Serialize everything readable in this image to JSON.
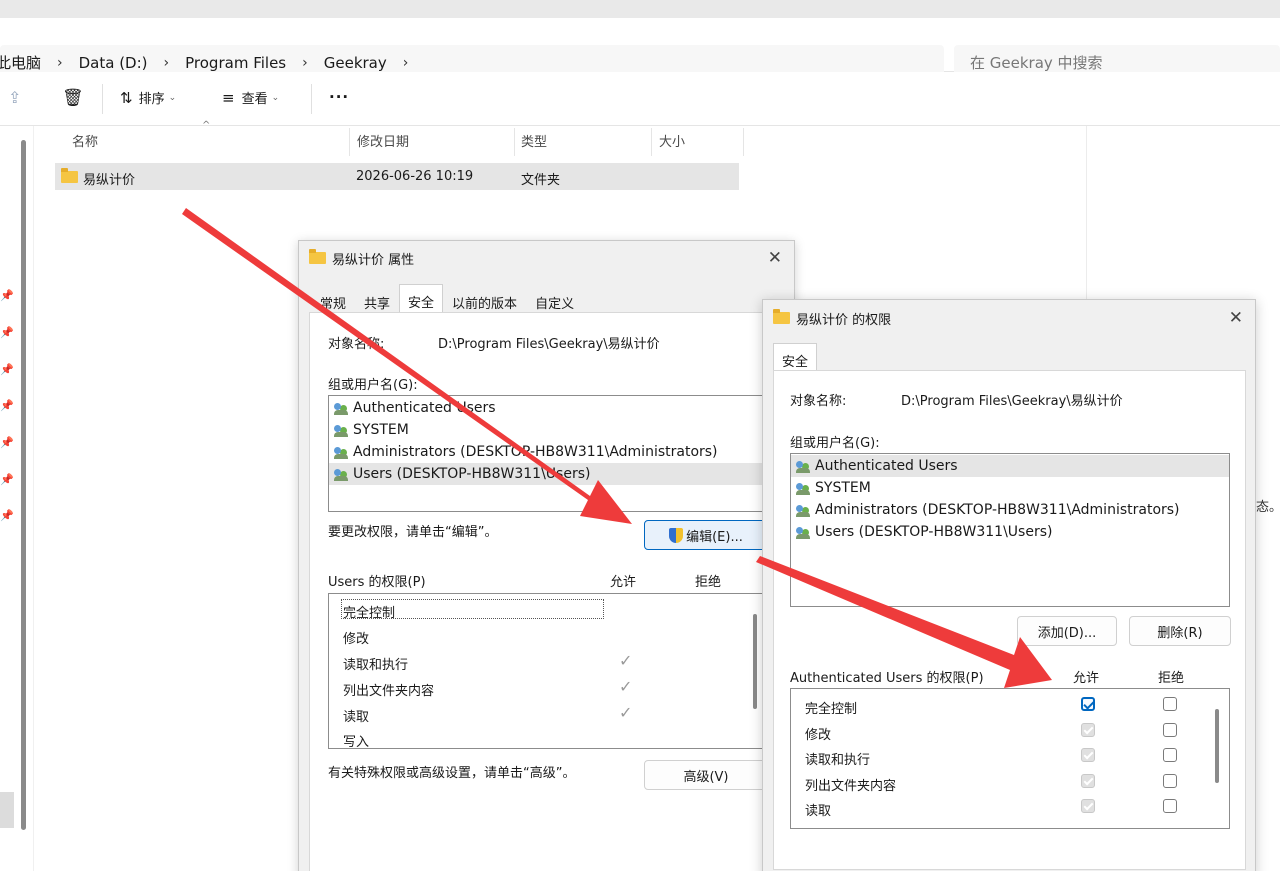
{
  "breadcrumb": {
    "items": [
      "此电脑",
      "Data (D:)",
      "Program Files",
      "Geekray"
    ],
    "trailing_sep": "›"
  },
  "search": {
    "placeholder": "在 Geekray 中搜索"
  },
  "toolbar": {
    "sort_label": "排序",
    "view_label": "查看",
    "more_label": "···"
  },
  "columns": {
    "name": "名称",
    "modified": "修改日期",
    "type": "类型",
    "size": "大小"
  },
  "files": [
    {
      "name": "易纵计价",
      "modified": "2026-06-26 10:19",
      "type": "文件夹"
    }
  ],
  "clipped_text": "态。",
  "properties_dialog": {
    "title": "易纵计价 属性",
    "tabs": [
      "常规",
      "共享",
      "安全",
      "以前的版本",
      "自定义"
    ],
    "active_tab": "安全",
    "object_label": "对象名称:",
    "object_value": "D:\\Program Files\\Geekray\\易纵计价",
    "group_label": "组或用户名(G):",
    "users": [
      "Authenticated Users",
      "SYSTEM",
      "Administrators (DESKTOP-HB8W311\\Administrators)",
      "Users (DESKTOP-HB8W311\\Users)"
    ],
    "selected_user_index": 3,
    "edit_hint": "要更改权限，请单击“编辑”。",
    "edit_button": "编辑(E)...",
    "perm_label": "Users 的权限(P)",
    "allow_label": "允许",
    "deny_label": "拒绝",
    "permissions": [
      {
        "name": "完全控制",
        "allow": false,
        "deny": false
      },
      {
        "name": "修改",
        "allow": false,
        "deny": false
      },
      {
        "name": "读取和执行",
        "allow": true,
        "deny": false
      },
      {
        "name": "列出文件夹内容",
        "allow": true,
        "deny": false
      },
      {
        "name": "读取",
        "allow": true,
        "deny": false
      },
      {
        "name": "写入",
        "allow": false,
        "deny": false
      }
    ],
    "advanced_hint": "有关特殊权限或高级设置，请单击“高级”。",
    "advanced_button": "高级(V)"
  },
  "permissions_dialog": {
    "title": "易纵计价 的权限",
    "tab": "安全",
    "object_label": "对象名称:",
    "object_value": "D:\\Program Files\\Geekray\\易纵计价",
    "group_label": "组或用户名(G):",
    "users": [
      "Authenticated Users",
      "SYSTEM",
      "Administrators (DESKTOP-HB8W311\\Administrators)",
      "Users (DESKTOP-HB8W311\\Users)"
    ],
    "selected_user_index": 0,
    "add_button": "添加(D)...",
    "remove_button": "删除(R)",
    "perm_label": "Authenticated Users 的权限(P)",
    "allow_label": "允许",
    "deny_label": "拒绝",
    "permissions": [
      {
        "name": "完全控制",
        "allow": "checked-editable",
        "deny": false
      },
      {
        "name": "修改",
        "allow": "checked-disabled",
        "deny": false
      },
      {
        "name": "读取和执行",
        "allow": "checked-disabled",
        "deny": false
      },
      {
        "name": "列出文件夹内容",
        "allow": "checked-disabled",
        "deny": false
      },
      {
        "name": "读取",
        "allow": "checked-disabled",
        "deny": false
      }
    ]
  },
  "colors": {
    "accent": "#0067c0",
    "arrow": "#ee3b3b",
    "folder": "#f5c542",
    "selection": "#e5e5e5"
  }
}
